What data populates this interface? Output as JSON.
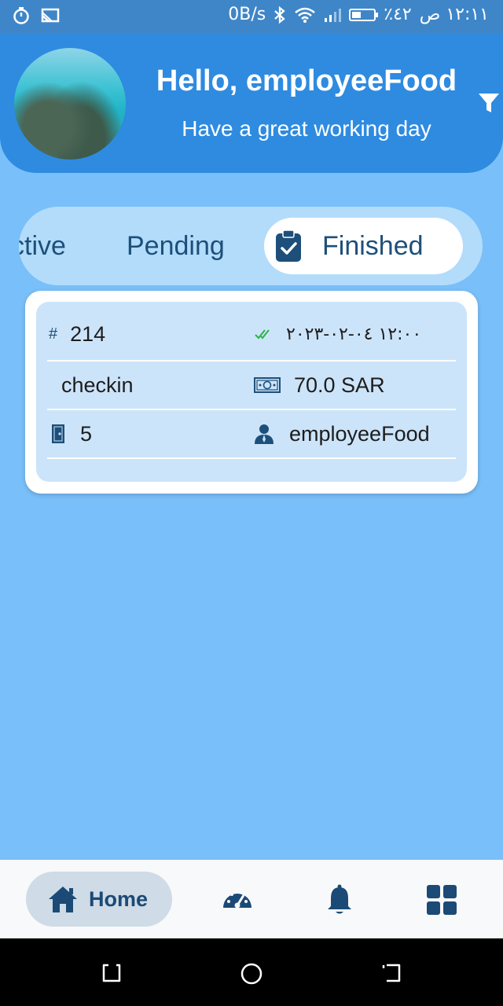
{
  "status_bar": {
    "net_speed": "0B/s",
    "battery_percent": "٪٤٢",
    "time": "١٢:١١ ص",
    "battery_level": 0.42
  },
  "header": {
    "greeting": "Hello, employeeFood",
    "subtitle": "Have a great working day"
  },
  "tabs": {
    "items": [
      {
        "label": "ctive",
        "icon": ""
      },
      {
        "label": "Pending",
        "icon": ""
      },
      {
        "label": "Finished",
        "icon": "clipboard-check-icon"
      }
    ],
    "selected": "Finished"
  },
  "order_card": {
    "number": "214",
    "datetime": "١٢:٠٠ ٠٤-٠٢-٢٠٢٣",
    "type": "checkin",
    "amount": "70.0 SAR",
    "room": "5",
    "employee": "employeeFood"
  },
  "bottom_nav": {
    "home_label": "Home",
    "icons": [
      "home-icon",
      "dashboard-icon",
      "bell-icon",
      "grid-icon"
    ]
  },
  "colors": {
    "header_blue": "#2e8be0",
    "background": "#79bff9",
    "dark_blue": "#1d4f7a",
    "check_green": "#2db34a"
  }
}
